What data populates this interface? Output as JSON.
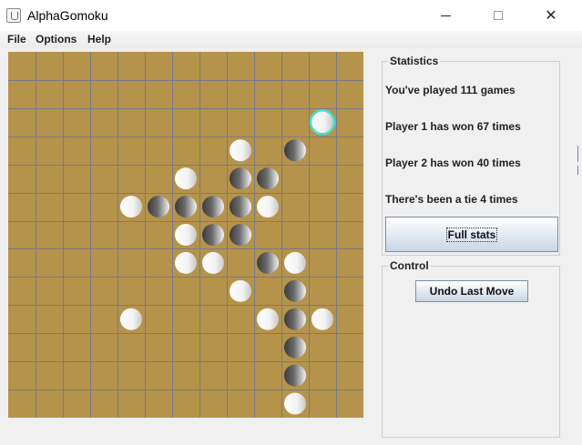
{
  "window": {
    "title": "AlphaGomoku",
    "app_icon": "java-cup-icon",
    "controls": [
      "minimize-icon",
      "maximize-icon",
      "close-icon"
    ],
    "close_glyph": "✕"
  },
  "menu": {
    "items": [
      "File",
      "Options",
      "Help"
    ]
  },
  "board": {
    "background_color": "#b5934a",
    "grid_color": "#7a7a8a",
    "columns": 13,
    "rows": 13,
    "highlight_color": "#40e0d0",
    "last_move": {
      "col": 11,
      "row": 2
    },
    "stones": [
      {
        "col": 11,
        "row": 2,
        "color": "white"
      },
      {
        "col": 8,
        "row": 3,
        "color": "white"
      },
      {
        "col": 10,
        "row": 3,
        "color": "black"
      },
      {
        "col": 6,
        "row": 4,
        "color": "white"
      },
      {
        "col": 8,
        "row": 4,
        "color": "black"
      },
      {
        "col": 9,
        "row": 4,
        "color": "black"
      },
      {
        "col": 4,
        "row": 5,
        "color": "white"
      },
      {
        "col": 5,
        "row": 5,
        "color": "black"
      },
      {
        "col": 6,
        "row": 5,
        "color": "black"
      },
      {
        "col": 7,
        "row": 5,
        "color": "black"
      },
      {
        "col": 8,
        "row": 5,
        "color": "black"
      },
      {
        "col": 9,
        "row": 5,
        "color": "white"
      },
      {
        "col": 6,
        "row": 6,
        "color": "white"
      },
      {
        "col": 7,
        "row": 6,
        "color": "black"
      },
      {
        "col": 8,
        "row": 6,
        "color": "black"
      },
      {
        "col": 6,
        "row": 7,
        "color": "white"
      },
      {
        "col": 7,
        "row": 7,
        "color": "white"
      },
      {
        "col": 9,
        "row": 7,
        "color": "black"
      },
      {
        "col": 10,
        "row": 7,
        "color": "white"
      },
      {
        "col": 8,
        "row": 8,
        "color": "white"
      },
      {
        "col": 10,
        "row": 8,
        "color": "black"
      },
      {
        "col": 4,
        "row": 9,
        "color": "white"
      },
      {
        "col": 9,
        "row": 9,
        "color": "white"
      },
      {
        "col": 10,
        "row": 9,
        "color": "black"
      },
      {
        "col": 11,
        "row": 9,
        "color": "white"
      },
      {
        "col": 10,
        "row": 10,
        "color": "black"
      },
      {
        "col": 10,
        "row": 11,
        "color": "black"
      },
      {
        "col": 10,
        "row": 12,
        "color": "white"
      }
    ]
  },
  "statistics": {
    "legend": "Statistics",
    "games_played": "You've played 111 games",
    "player1_wins": "Player 1 has won 67 times",
    "player2_wins": "Player 2 has won 40 times",
    "ties": "There's been a tie 4 times",
    "full_stats_label": "Full stats"
  },
  "control": {
    "legend": "Control",
    "undo_label": "Undo Last Move"
  }
}
